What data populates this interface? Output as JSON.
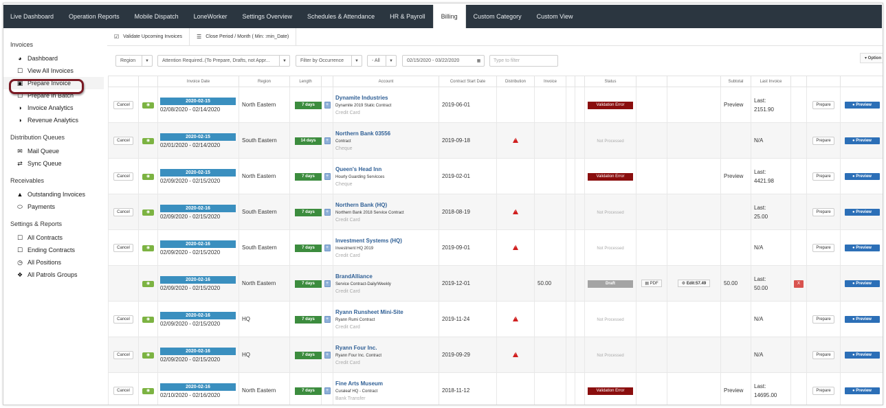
{
  "topnav": [
    "Live Dashboard",
    "Operation Reports",
    "Mobile Dispatch",
    "LoneWorker",
    "Settings Overview",
    "Schedules & Attendance",
    "HR & Payroll",
    "Billing",
    "Custom Category",
    "Custom View"
  ],
  "topnav_active": "Billing",
  "sidebar": {
    "sections": [
      {
        "title": "Invoices",
        "items": [
          {
            "label": "Dashboard",
            "icon": "pie-chart-icon"
          },
          {
            "label": "View All Invoices",
            "icon": "document-icon"
          },
          {
            "label": "Prepare Invoice",
            "icon": "monitor-icon"
          },
          {
            "label": "Prepare in Batch",
            "icon": "document-icon"
          },
          {
            "label": "Invoice Analytics",
            "icon": "globe-icon"
          },
          {
            "label": "Revenue Analytics",
            "icon": "globe-icon"
          }
        ]
      },
      {
        "title": "Distribution Queues",
        "items": [
          {
            "label": "Mail Queue",
            "icon": "envelope-icon"
          },
          {
            "label": "Sync Queue",
            "icon": "swap-icon"
          }
        ]
      },
      {
        "title": "Receivables",
        "items": [
          {
            "label": "Outstanding Invoices",
            "icon": "warning-icon"
          },
          {
            "label": "Payments",
            "icon": "card-icon"
          }
        ]
      },
      {
        "title": "Settings & Reports",
        "items": [
          {
            "label": "All Contracts",
            "icon": "document-icon"
          },
          {
            "label": "Ending Contracts",
            "icon": "document-icon"
          },
          {
            "label": "All Positions",
            "icon": "clock-icon"
          },
          {
            "label": "All Patrols Groups",
            "icon": "car-icon"
          }
        ]
      }
    ]
  },
  "toolbar": {
    "validate_label": "Validate Upcoming Invoices",
    "close_period_label": "Close Period / Month ( Min: :min_Date)"
  },
  "filters": {
    "region": "Region",
    "attention": "Attention Required..(To Prepare, Drafts, not Appr...",
    "occurrence": "Filter by Occurrence",
    "all": "- All",
    "date_range": "02/15/2020 - 03/22/2020",
    "type_placeholder": "Type to filter",
    "options_label": "Option"
  },
  "table": {
    "headers": [
      "",
      "",
      "Invoice Date",
      "Region",
      "Length",
      "",
      "Account",
      "Contract Start Date",
      "Distribution",
      "Invoice",
      "",
      "",
      "Status",
      "",
      "",
      "Subtotal",
      "Last Invoice",
      "",
      "",
      ""
    ],
    "cancel_label": "Cancel",
    "prepare_label": "Prepare",
    "preview_label": "Preview",
    "pdf_label": "PDF",
    "plus_label": "+",
    "x_label": "X",
    "rows": [
      {
        "cancel": true,
        "date": "2020-02-15",
        "range": "02/08/2020 - 02/14/2020",
        "region": "North Eastern",
        "length": "7 days",
        "account": "Dynamite Industries",
        "contract": "Dynamite 2019 Static Contract",
        "payment": "Credit Card",
        "start": "2019-06-01",
        "warn": false,
        "invoice": "",
        "status": "Validation Error",
        "status_type": "error",
        "pdf": false,
        "edit": "",
        "subtotal": "",
        "preview_text": "Preview",
        "last_label": "Last:",
        "last_value": "2151.90",
        "x": false,
        "prepare": true
      },
      {
        "cancel": true,
        "date": "2020-02-15",
        "range": "02/01/2020 - 02/14/2020",
        "region": "South Eastern",
        "length": "14 days",
        "account": "Northern Bank 03556",
        "contract": "Contract",
        "payment": "Cheque",
        "start": "2019-09-18",
        "warn": true,
        "invoice": "",
        "status": "Not Processed",
        "status_type": "np",
        "pdf": false,
        "edit": "",
        "subtotal": "",
        "preview_text": "",
        "last_label": "N/A",
        "last_value": "",
        "x": false,
        "prepare": true
      },
      {
        "cancel": true,
        "date": "2020-02-15",
        "range": "02/09/2020 - 02/15/2020",
        "region": "North Eastern",
        "length": "7 days",
        "account": "Queen's Head Inn",
        "contract": "Hourly Guarding Servicces",
        "payment": "Cheque",
        "start": "2019-02-01",
        "warn": false,
        "invoice": "",
        "status": "Validation Error",
        "status_type": "error",
        "pdf": false,
        "edit": "",
        "subtotal": "",
        "preview_text": "Preview",
        "last_label": "Last:",
        "last_value": "4421.98",
        "x": false,
        "prepare": true
      },
      {
        "cancel": true,
        "date": "2020-02-16",
        "range": "02/09/2020 - 02/15/2020",
        "region": "South Eastern",
        "length": "7 days",
        "account": "Northern Bank (HQ)",
        "contract": "Northern Bank 2018 Service Contract",
        "payment": "Credit Card",
        "start": "2018-08-19",
        "warn": true,
        "invoice": "",
        "status": "Not Processed",
        "status_type": "np",
        "pdf": false,
        "edit": "",
        "subtotal": "",
        "preview_text": "",
        "last_label": "Last:",
        "last_value": "25.00",
        "x": false,
        "prepare": true
      },
      {
        "cancel": true,
        "date": "2020-02-16",
        "range": "02/09/2020 - 02/15/2020",
        "region": "South Eastern",
        "length": "7 days",
        "account": "Investment Systems (HQ)",
        "contract": "Investment HQ 2019",
        "payment": "Credit Card",
        "start": "2019-09-01",
        "warn": true,
        "invoice": "",
        "status": "Not Processed",
        "status_type": "np",
        "pdf": false,
        "edit": "",
        "subtotal": "",
        "preview_text": "",
        "last_label": "N/A",
        "last_value": "",
        "x": false,
        "prepare": true
      },
      {
        "cancel": false,
        "date": "2020-02-16",
        "range": "02/09/2020 - 02/15/2020",
        "region": "North Eastern",
        "length": "7 days",
        "account": "BrandAlliance",
        "contract": "Service Contract-Daily/Weekly",
        "payment": "Credit Card",
        "start": "2019-12-01",
        "warn": false,
        "invoice": "50.00",
        "status": "Draft",
        "status_type": "draft",
        "pdf": true,
        "edit": "Edit:57.49",
        "subtotal": "50.00",
        "preview_text": "",
        "last_label": "Last:",
        "last_value": "50.00",
        "x": true,
        "prepare": false
      },
      {
        "cancel": true,
        "date": "2020-02-16",
        "range": "02/09/2020 - 02/15/2020",
        "region": "HQ",
        "length": "7 days",
        "account": "Ryann Runsheet Mini-Site",
        "contract": "Ryann Rumi Contract",
        "payment": "Credit Card",
        "start": "2019-11-24",
        "warn": true,
        "invoice": "",
        "status": "Not Processed",
        "status_type": "np",
        "pdf": false,
        "edit": "",
        "subtotal": "",
        "preview_text": "",
        "last_label": "N/A",
        "last_value": "",
        "x": false,
        "prepare": true
      },
      {
        "cancel": true,
        "date": "2020-02-16",
        "range": "02/09/2020 - 02/15/2020",
        "region": "HQ",
        "length": "7 days",
        "account": "Ryann Four Inc.",
        "contract": "Ryann Four Inc. Contract",
        "payment": "Credit Card",
        "start": "2019-09-29",
        "warn": true,
        "invoice": "",
        "status": "Not Processed",
        "status_type": "np",
        "pdf": false,
        "edit": "",
        "subtotal": "",
        "preview_text": "",
        "last_label": "N/A",
        "last_value": "",
        "x": false,
        "prepare": true
      },
      {
        "cancel": true,
        "date": "2020-02-16",
        "range": "02/10/2020 - 02/16/2020",
        "region": "North Eastern",
        "length": "7 days",
        "account": "Fine Arts Museum",
        "contract": "Curaleaf HQ - Contract",
        "payment": "Bank Transfer",
        "start": "2018-11-12",
        "warn": false,
        "invoice": "",
        "status": "Validation Error",
        "status_type": "error",
        "pdf": false,
        "edit": "",
        "subtotal": "",
        "preview_text": "Preview",
        "last_label": "Last:",
        "last_value": "14695.00",
        "x": false,
        "prepare": true
      }
    ]
  },
  "colors": {
    "nav_bg": "#2b3640",
    "date_badge": "#3a8fbf",
    "length_badge": "#3c8c3e",
    "error": "#8a0e0e",
    "preview": "#2c6fb7",
    "highlight_ring": "#7a1a24"
  }
}
